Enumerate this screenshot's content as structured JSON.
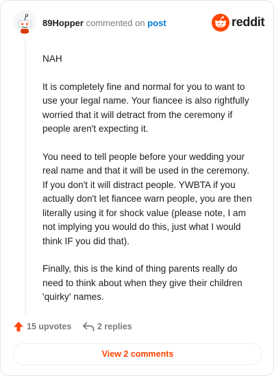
{
  "header": {
    "username": "89Hopper",
    "commented_text": "commented on",
    "post_link": "post",
    "logo_text": "reddit"
  },
  "comment": {
    "paragraphs": [
      "NAH",
      "It is completely fine and normal for you to want to use your legal name. Your fiancee is also rightfully worried that it will detract from the ceremony if people aren't expecting it.",
      "You need to tell people before your wedding your real name and that it will be used in the ceremony. If you don't it will distract people. YWBTA if you actually don't let fiancee warn people, you are then literally using it for shock value (please note, I am not implying you would do this, just what I would think IF you did that).",
      "Finally, this is the kind of thing parents really do need to think about when they give their children 'quirky' names."
    ]
  },
  "actions": {
    "upvotes": "15 upvotes",
    "replies": "2 replies"
  },
  "view_button": "View 2 comments",
  "colors": {
    "accent": "#ff4500",
    "link": "#0079d3",
    "muted": "#7c7c7c"
  }
}
